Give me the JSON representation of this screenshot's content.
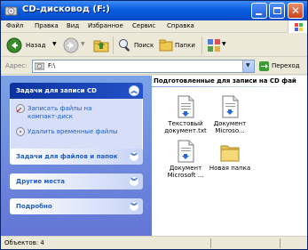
{
  "window": {
    "title": "CD-дисковод (F:)"
  },
  "menu": {
    "items": [
      "Файл",
      "Правка",
      "Вид",
      "Избранное",
      "Сервис",
      "Справка"
    ]
  },
  "toolbar": {
    "back_label": "Назад",
    "search_label": "Поиск",
    "folders_label": "Папки"
  },
  "address": {
    "label": "Адрес:",
    "value": "F:\\",
    "go_label": "Переход"
  },
  "tasks": {
    "cd_group": {
      "title": "Задачи для записи CD",
      "links": [
        {
          "label_line1": "Записать файлы на",
          "label_line2": "компакт-диск",
          "icon": "cd-write-icon"
        },
        {
          "label_line1": "Удалить временные файлы",
          "icon": "delete-temp-icon"
        }
      ]
    },
    "files_group": {
      "title": "Задачи для файлов и папок"
    },
    "other_group": {
      "title": "Другие места"
    },
    "details_group": {
      "title": "Подробно"
    }
  },
  "content": {
    "heading": "Подготовленные для записи на CD фай",
    "files": [
      {
        "line1": "Текстовый",
        "line2": "документ.txt",
        "icon": "text-document-icon"
      },
      {
        "line1": "Документ",
        "line2": "Microso...",
        "icon": "word-document-icon"
      },
      {
        "line1": "Документ",
        "line2": "Microsoft ...",
        "icon": "word-document-icon"
      },
      {
        "line1": "Новая папка",
        "line2": "",
        "icon": "folder-icon"
      }
    ]
  },
  "status": {
    "objects": "Объектов: 4"
  },
  "colors": {
    "titlebar": "#0452d4",
    "taskpane_top": "#7ba2e7",
    "taskpane_bottom": "#6375d6",
    "link": "#215dc6",
    "dark_header": "#0c32a0"
  }
}
